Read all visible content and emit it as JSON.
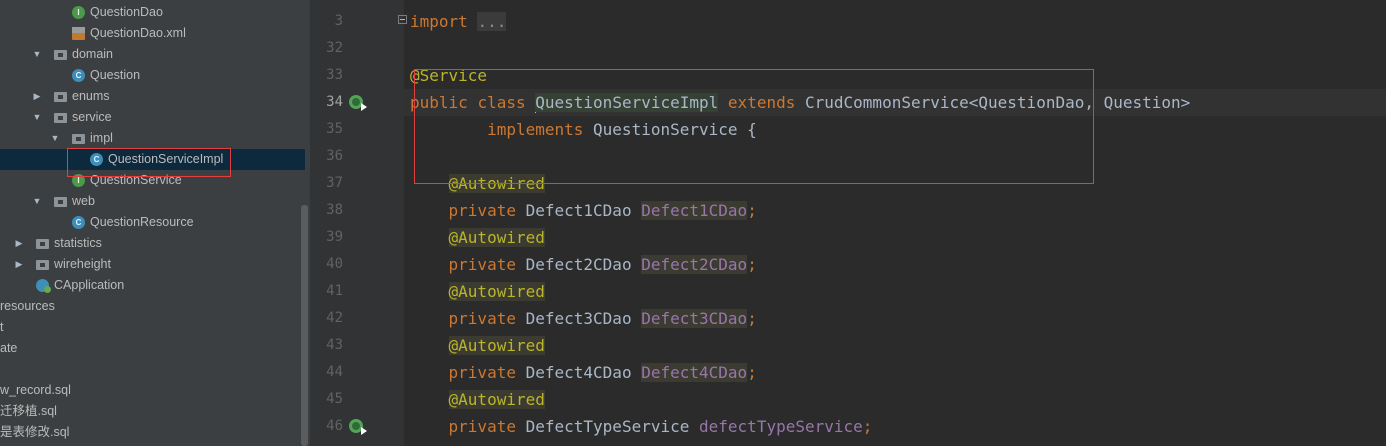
{
  "project_tree": {
    "items": [
      {
        "label": "QuestionDao",
        "icon": "interface-icon",
        "arrow": "",
        "depth": 3
      },
      {
        "label": "QuestionDao.xml",
        "icon": "xml-file-icon",
        "arrow": "",
        "depth": 3
      },
      {
        "label": "domain",
        "icon": "package-folder-icon",
        "arrow": "expanded",
        "depth": 2
      },
      {
        "label": "Question",
        "icon": "class-icon",
        "arrow": "",
        "depth": 3
      },
      {
        "label": "enums",
        "icon": "package-folder-icon",
        "arrow": "collapsed",
        "depth": 2
      },
      {
        "label": "service",
        "icon": "package-folder-icon",
        "arrow": "expanded",
        "depth": 2
      },
      {
        "label": "impl",
        "icon": "package-folder-icon",
        "arrow": "expanded",
        "depth": 3
      },
      {
        "label": "QuestionServiceImpl",
        "icon": "class-icon",
        "arrow": "",
        "depth": 4,
        "selected": true
      },
      {
        "label": "QuestionService",
        "icon": "interface-icon",
        "arrow": "",
        "depth": 3
      },
      {
        "label": "web",
        "icon": "package-folder-icon",
        "arrow": "expanded",
        "depth": 2
      },
      {
        "label": "QuestionResource",
        "icon": "class-icon",
        "arrow": "",
        "depth": 3
      },
      {
        "label": "statistics",
        "icon": "package-folder-icon",
        "arrow": "collapsed",
        "depth": 1
      },
      {
        "label": "wireheight",
        "icon": "package-folder-icon",
        "arrow": "collapsed",
        "depth": 1
      },
      {
        "label": "CApplication",
        "icon": "spring-boot-class-icon",
        "arrow": "",
        "depth": 1
      },
      {
        "label": "resources",
        "icon": "",
        "arrow": "",
        "depth": 0
      },
      {
        "label": "t",
        "icon": "",
        "arrow": "",
        "depth": 0
      },
      {
        "label": "ate",
        "icon": "",
        "arrow": "",
        "depth": 0
      },
      {
        "label": "",
        "icon": "",
        "arrow": "",
        "depth": 0
      },
      {
        "label": "w_record.sql",
        "icon": "",
        "arrow": "",
        "depth": 0
      },
      {
        "label": "迁移植.sql",
        "icon": "",
        "arrow": "",
        "depth": 0
      },
      {
        "label": "是表修改.sql",
        "icon": "",
        "arrow": "",
        "depth": 0
      }
    ]
  },
  "editor": {
    "line_numbers": [
      "3",
      "32",
      "33",
      "34",
      "35",
      "36",
      "37",
      "38",
      "39",
      "40",
      "41",
      "42",
      "43",
      "44",
      "45",
      "46"
    ],
    "current_line": "34",
    "lines": {
      "l3": {
        "kw": "import",
        "folded": "..."
      },
      "l33": {
        "ann": "@Service"
      },
      "l34": {
        "kw1": "public",
        "kw2": "class",
        "name": "QuestionServiceImpl",
        "kw3": "extends",
        "rest": "CrudCommonService<QuestionDao, Question>"
      },
      "l35": {
        "kw": "implements",
        "rest": "QuestionService {"
      },
      "l37": {
        "ann": "@Autowired"
      },
      "l38": {
        "kw": "private",
        "type": "Defect1CDao",
        "field": "Defect1CDao",
        "semi": ";"
      },
      "l39": {
        "ann": "@Autowired"
      },
      "l40": {
        "kw": "private",
        "type": "Defect2CDao",
        "field": "Defect2CDao",
        "semi": ";"
      },
      "l41": {
        "ann": "@Autowired"
      },
      "l42": {
        "kw": "private",
        "type": "Defect3CDao",
        "field": "Defect3CDao",
        "semi": ";"
      },
      "l43": {
        "ann": "@Autowired"
      },
      "l44": {
        "kw": "private",
        "type": "Defect4CDao",
        "field": "Defect4CDao",
        "semi": ";"
      },
      "l45": {
        "ann": "@Autowired"
      },
      "l46": {
        "kw": "private",
        "type": "DefectTypeService",
        "field": "defectTypeService",
        "semi": ";"
      }
    }
  },
  "colors": {
    "keyword": "#cc7832",
    "annotation": "#bbb529",
    "field": "#9876aa",
    "highlight_box": "#e04040"
  }
}
